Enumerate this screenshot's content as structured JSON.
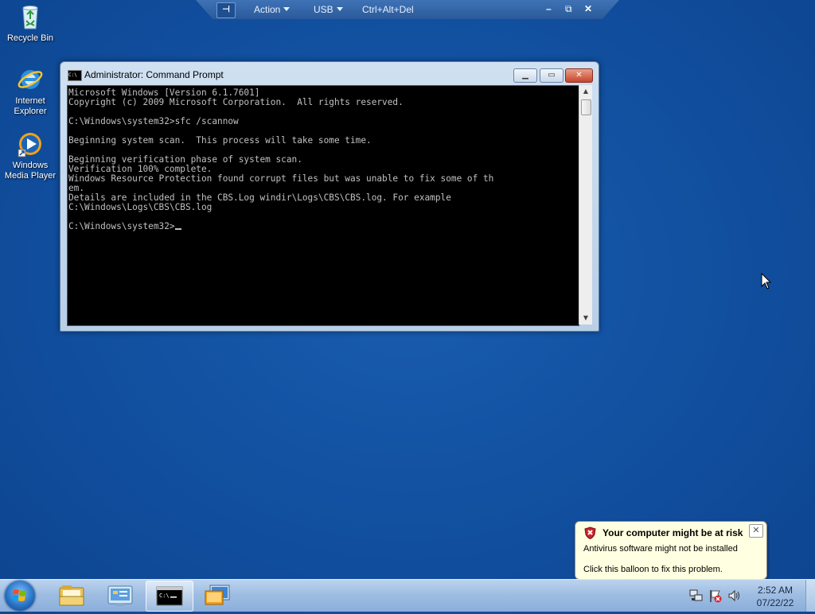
{
  "remote_toolbar": {
    "pin_label": "⊣",
    "menus": [
      {
        "label": "Action"
      },
      {
        "label": "USB"
      }
    ],
    "ctrl_alt_del": "Ctrl+Alt+Del",
    "minimize": "–",
    "restore": "⧉",
    "close": "✕"
  },
  "desktop": {
    "icons": [
      {
        "label": "Recycle Bin",
        "icon": "recycle-bin-icon"
      },
      {
        "label": "Internet Explorer",
        "icon": "internet-explorer-icon"
      },
      {
        "label": "Windows Media Player",
        "icon": "windows-media-player-icon"
      }
    ]
  },
  "cmd_window": {
    "title": "Administrator: Command Prompt",
    "icon_text": "C:\\",
    "lines": [
      "Microsoft Windows [Version 6.1.7601]",
      "Copyright (c) 2009 Microsoft Corporation.  All rights reserved.",
      "",
      "C:\\Windows\\system32>sfc /scannow",
      "",
      "Beginning system scan.  This process will take some time.",
      "",
      "Beginning verification phase of system scan.",
      "Verification 100% complete.",
      "Windows Resource Protection found corrupt files but was unable to fix some of th",
      "em.",
      "Details are included in the CBS.Log windir\\Logs\\CBS\\CBS.log. For example",
      "C:\\Windows\\Logs\\CBS\\CBS.log",
      ""
    ],
    "prompt": "C:\\Windows\\system32>"
  },
  "balloon": {
    "title": "Your computer might be at risk",
    "line1": "Antivirus software might not be installed",
    "line2": "Click this balloon to fix this problem.",
    "close": "✕"
  },
  "taskbar": {
    "clock_time": "2:52 AM",
    "clock_date": "07/22/22",
    "pinned": [
      {
        "name": "windows-explorer",
        "icon": "folder-icon"
      },
      {
        "name": "control-panel",
        "icon": "control-panel-icon"
      },
      {
        "name": "command-prompt",
        "icon": "cmd-icon",
        "active": true
      },
      {
        "name": "remote-desktop",
        "icon": "remote-desktop-icon"
      }
    ],
    "tray_icons": [
      "network-icon",
      "action-center-flag-icon",
      "volume-icon"
    ]
  }
}
